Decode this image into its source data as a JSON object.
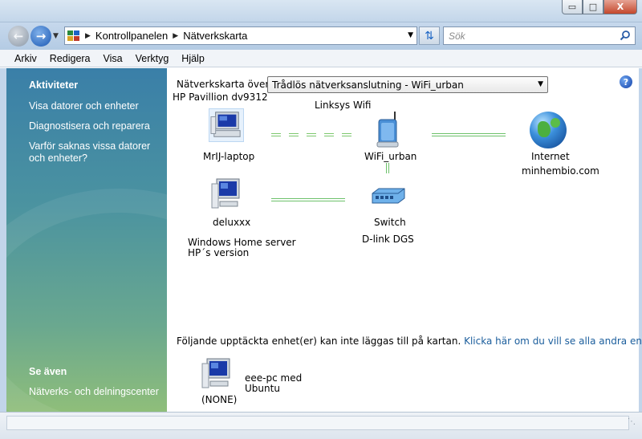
{
  "window": {
    "controls": {
      "minimize": "▭",
      "maximize": "□",
      "close": "X"
    }
  },
  "nav": {
    "breadcrumb": [
      "Kontrollpanelen",
      "Nätverkskarta"
    ],
    "search_placeholder": "Sök"
  },
  "menu": [
    "Arkiv",
    "Redigera",
    "Visa",
    "Verktyg",
    "Hjälp"
  ],
  "sidebar": {
    "tasks_title": "Aktiviteter",
    "tasks": [
      "Visa datorer och enheter",
      "Diagnostisera och reparera",
      "Varför saknas vissa datorer och enheter?"
    ],
    "see_also_title": "Se även",
    "see_also": [
      "Nätverks- och delningscenter"
    ]
  },
  "map": {
    "header_label": "Nätverkskarta över",
    "host_name": "HP Pavillion dv9312",
    "network_select": "Trådlös nätverksanslutning - WiFi_urban",
    "router_caption": "Linksys Wifi",
    "nodes": {
      "laptop": "MrIJ-laptop",
      "router": "WiFi_urban",
      "internet": "Internet",
      "internet_sub": "minhembio.com",
      "server": "deluxxx",
      "server_sub1": "Windows Home server",
      "server_sub2": "HP´s version",
      "switch": "Switch",
      "switch_sub": "D-link DGS"
    },
    "unmapped_note": "Följande upptäckta enhet(er) kan inte läggas till på kartan.",
    "unmapped_link": "Klicka här om du vill se alla andra enheter.",
    "unmapped_device_line1": "eee-pc med",
    "unmapped_device_line2": "Ubuntu",
    "unmapped_device_ip": "(NONE)"
  },
  "icons": {
    "back": "arrow-left-icon",
    "forward": "arrow-right-icon",
    "refresh": "refresh-icon",
    "search": "search-icon",
    "help": "help-icon"
  },
  "colors": {
    "sidebar_top": "#3a7fa8",
    "sidebar_bottom": "#8fbe7a",
    "link_color": "#1a5d9c",
    "connection_line": "#6cc16a"
  }
}
